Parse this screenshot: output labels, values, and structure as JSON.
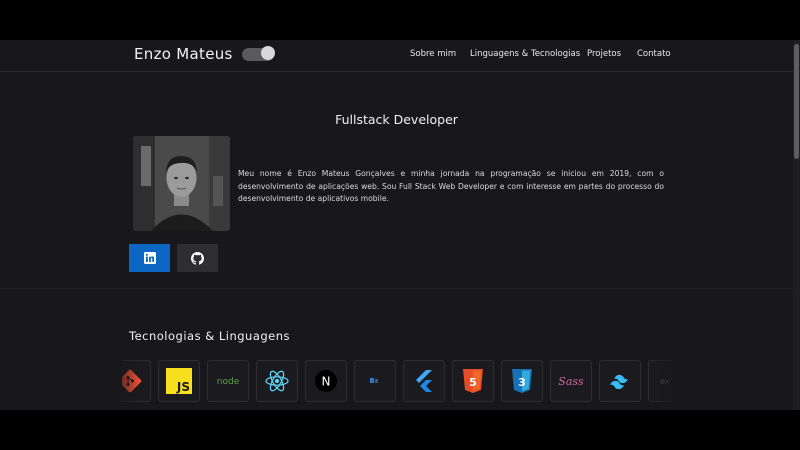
{
  "header": {
    "brand": "Enzo Mateus",
    "theme_toggle": "on",
    "nav": [
      {
        "label": "Sobre mim"
      },
      {
        "label": "Linguagens & Tecnologias"
      },
      {
        "label": "Projetos"
      },
      {
        "label": "Contato"
      }
    ]
  },
  "about": {
    "title": "Fullstack Developer",
    "bio": "Meu nome é Enzo Mateus Gonçalves e minha jornada na programação se iniciou em 2019, com o desenvolvimento de aplicações web. Sou Full Stack Web Developer e com interesse em partes do processo do desenvolvimento de aplicativos mobile.",
    "social": [
      {
        "icon": "linkedin-icon",
        "color": "#0a66c2"
      },
      {
        "icon": "github-icon",
        "color": "#2e2d31"
      }
    ]
  },
  "technologies": {
    "title": "Tecnologias & Linguagens",
    "items": [
      {
        "icon": "git-icon",
        "color": "#f05033"
      },
      {
        "icon": "javascript-icon",
        "label": "JS",
        "color": "#f7df1e"
      },
      {
        "icon": "nodejs-icon",
        "label": "node",
        "color": "#5fa04e"
      },
      {
        "icon": "react-icon",
        "color": "#61dafb"
      },
      {
        "icon": "nextjs-icon",
        "label": "N",
        "color": "#ffffff"
      },
      {
        "icon": "typescript-icon",
        "color": "#3178c6"
      },
      {
        "icon": "flutter-icon",
        "color": "#42a5f5"
      },
      {
        "icon": "html5-icon",
        "label": "5",
        "color": "#e44d26"
      },
      {
        "icon": "css3-icon",
        "label": "3",
        "color": "#1572b6"
      },
      {
        "icon": "sass-icon",
        "label": "Sass",
        "color": "#cd6799"
      },
      {
        "icon": "tailwind-icon",
        "color": "#38bdf8"
      },
      {
        "icon": "express-icon",
        "label": "ex",
        "color": "#6b6b6b"
      }
    ]
  },
  "colors": {
    "background": "#18171b",
    "linkedin": "#0a66c2"
  }
}
